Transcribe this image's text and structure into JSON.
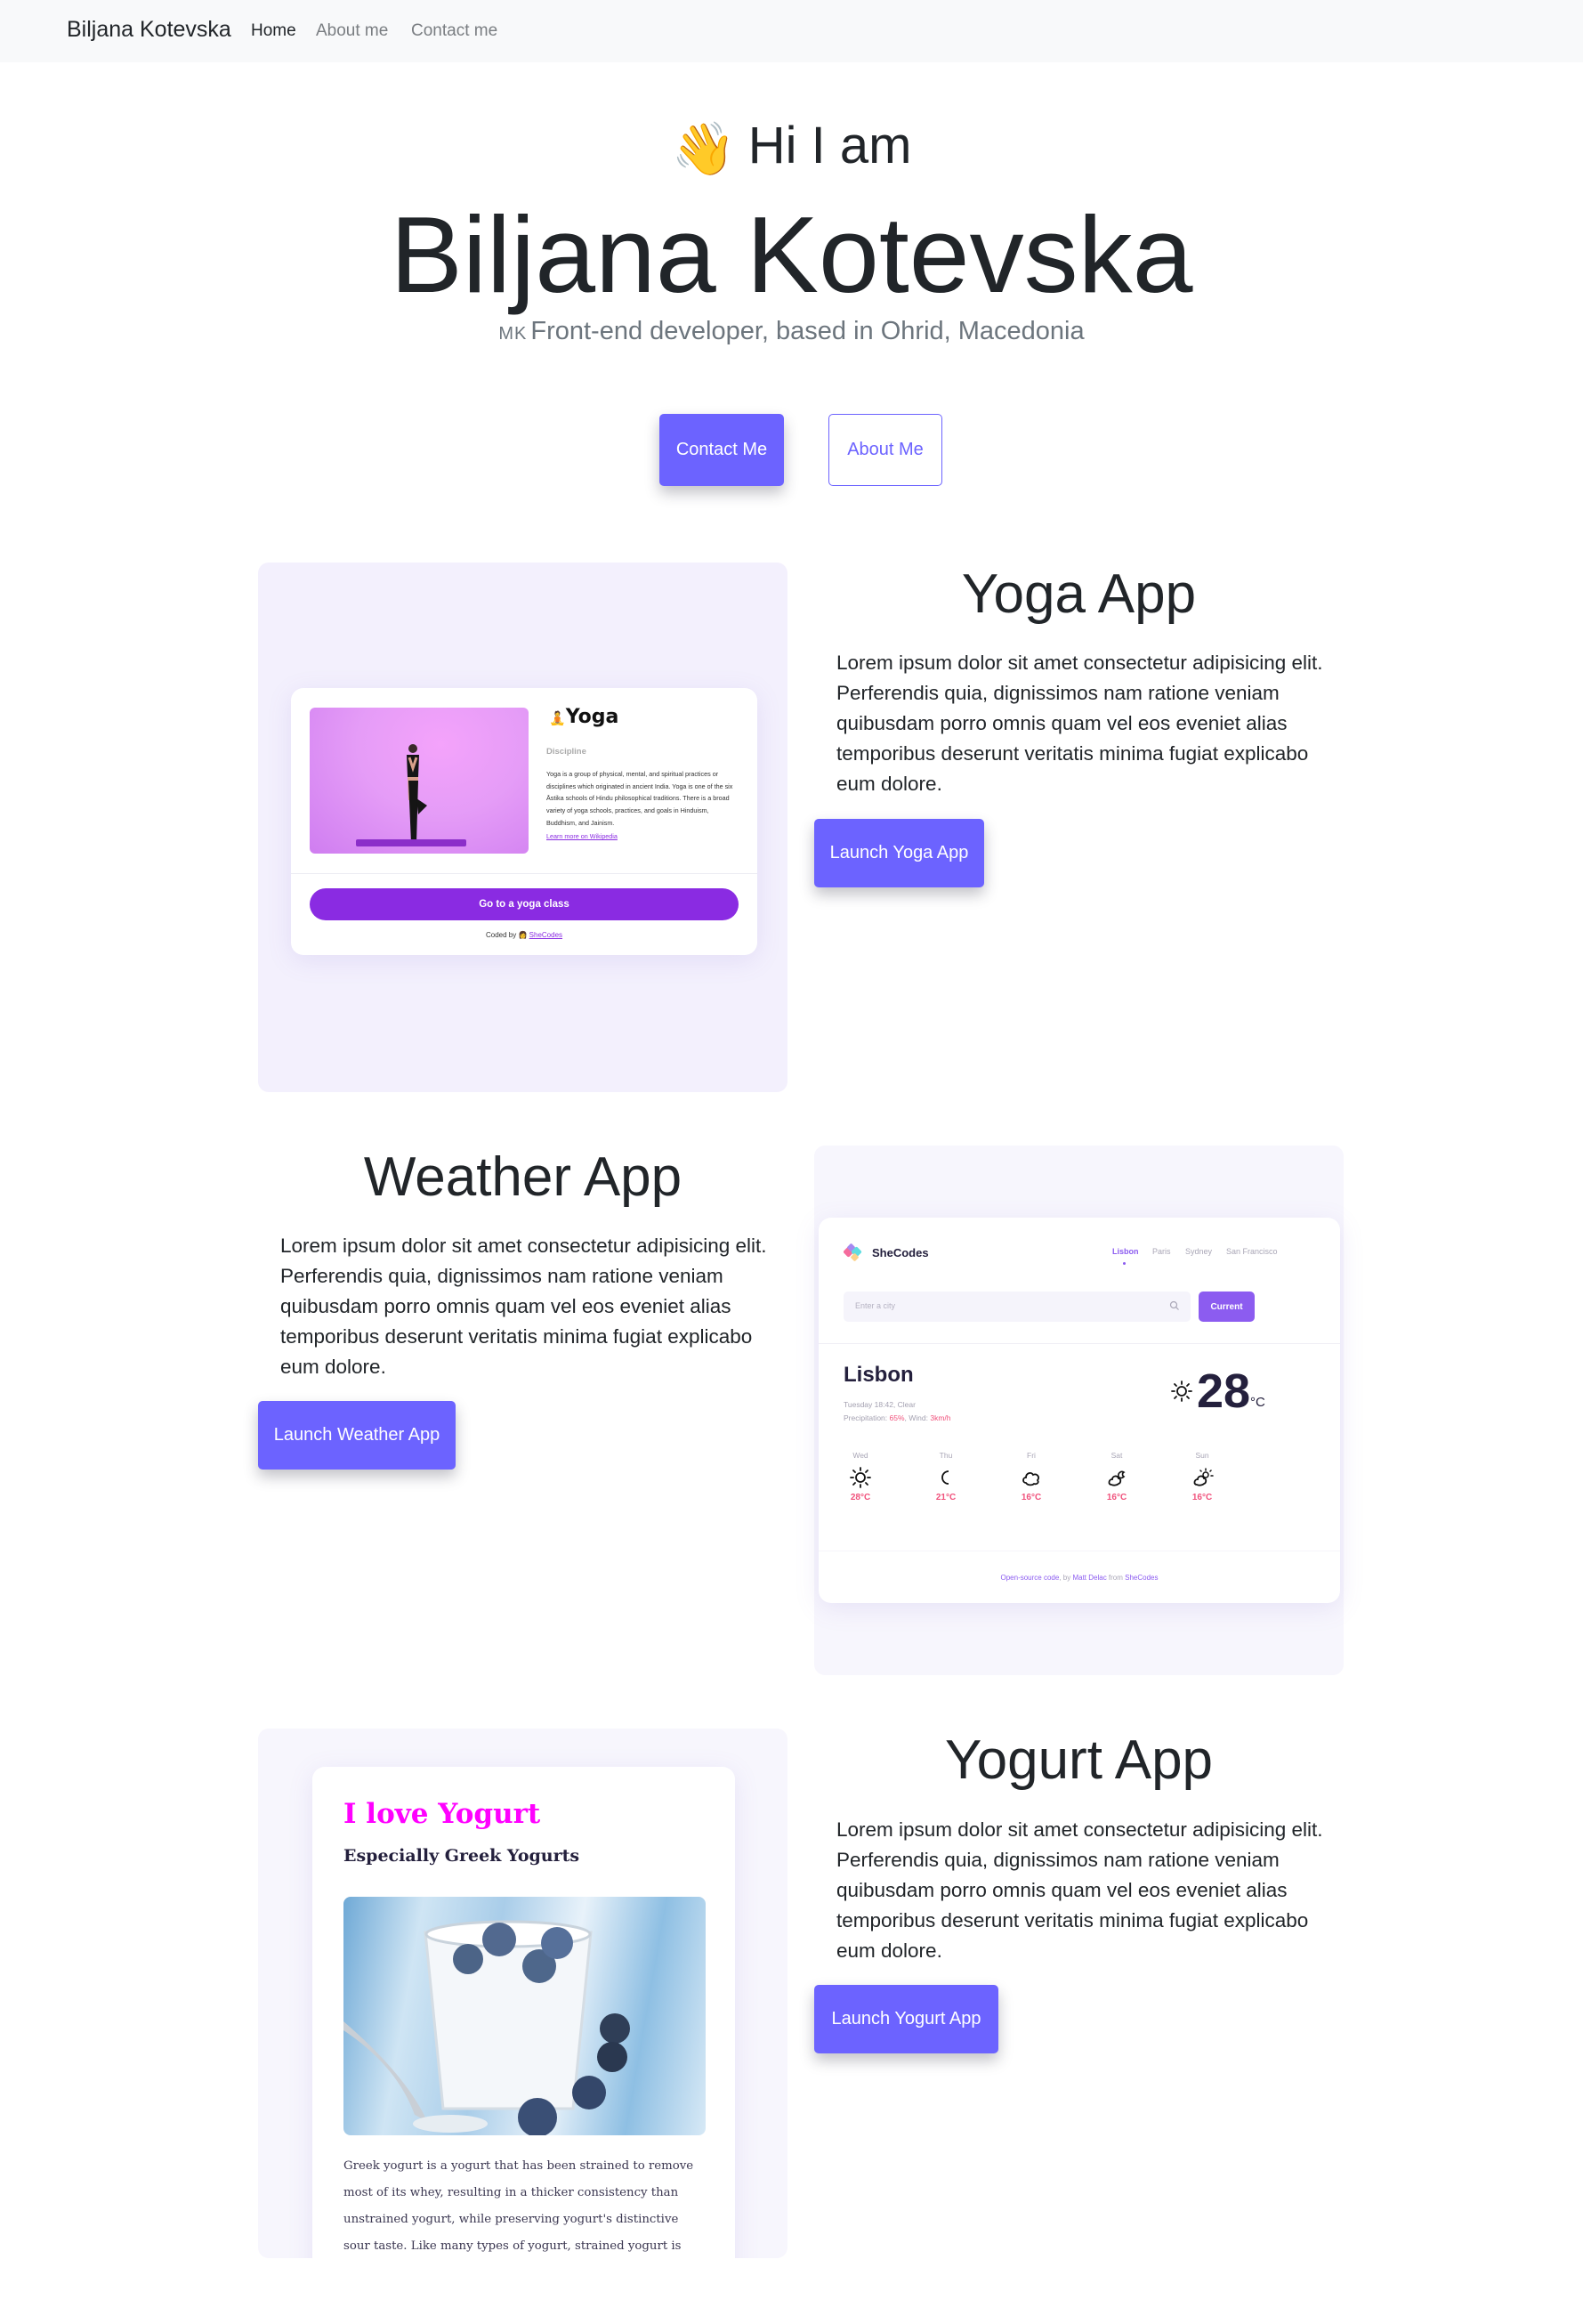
{
  "navbar": {
    "brand": "Biljana Kotevska",
    "links": [
      {
        "label": "Home",
        "active": true
      },
      {
        "label": "About me",
        "active": false
      },
      {
        "label": "Contact me",
        "active": false
      }
    ]
  },
  "hero": {
    "wave_icon": "👋",
    "greeting": "Hi I am",
    "name": "Biljana Kotevska",
    "flag": "MK",
    "subtitle": "Front-end developer, based in Ohrid, Macedonia",
    "contact_button": "Contact Me",
    "about_button": "About Me"
  },
  "colors": {
    "accent": "#6c63ff",
    "yoga_purple": "#8a2be2",
    "weather_purple": "#8c5cf0",
    "weather_pink": "#f0527c",
    "yogurt_magenta": "#ff00ff"
  },
  "projects": {
    "yoga": {
      "title": "Yoga App",
      "description": "Lorem ipsum dolor sit amet consectetur adipisicing elit. Perferendis quia, dignissimos nam ratione veniam quibusdam porro omnis quam vel eos eveniet alias temporibus deserunt veritatis minima fugiat explicabo eum dolore.",
      "launch_button": "Launch Yoga App",
      "preview": {
        "emoji": "🧘",
        "heading": "Yoga",
        "label": "Discipline",
        "text": "Yoga is a group of physical, mental, and spiritual practices or disciplines which originated in ancient India. Yoga is one of the six Āstika schools of Hindu philosophical traditions. There is a broad variety of yoga schools, practices, and goals in Hinduism, Buddhism, and Jainism.",
        "link": "Learn more on Wikipedia",
        "button": "Go to a yoga class",
        "footer_prefix": "Coded by",
        "footer_emoji": "👩",
        "footer_link": "SheCodes"
      }
    },
    "weather": {
      "title": "Weather App",
      "description": "Lorem ipsum dolor sit amet consectetur adipisicing elit. Perferendis quia, dignissimos nam ratione veniam quibusdam porro omnis quam vel eos eveniet alias temporibus deserunt veritatis minima fugiat explicabo eum dolore.",
      "launch_button": "Launch Weather App",
      "preview": {
        "logo_text": "SheCodes",
        "cities": [
          "Lisbon",
          "Paris",
          "Sydney",
          "San Francisco"
        ],
        "active_city": "Lisbon",
        "search_placeholder": "Enter a city",
        "current_button": "Current",
        "city": "Lisbon",
        "datetime": "Tuesday 18:42, Clear",
        "precip_label": "Precipitation:",
        "precip_value": "65%",
        "wind_label": ", Wind:",
        "wind_value": "3km/h",
        "temperature": "28",
        "unit": "°C",
        "now_icon": "sun-icon",
        "forecast": [
          {
            "day": "Wed",
            "icon": "sun-icon",
            "temp": "28°C"
          },
          {
            "day": "Thu",
            "icon": "moon-icon",
            "temp": "21°C"
          },
          {
            "day": "Fri",
            "icon": "cloud-icon",
            "temp": "16°C"
          },
          {
            "day": "Sat",
            "icon": "cloud-moon-icon",
            "temp": "16°C"
          },
          {
            "day": "Sun",
            "icon": "cloud-sun-icon",
            "temp": "16°C"
          }
        ],
        "footer": {
          "link1": "Open-source code",
          "by": ", by ",
          "author": "Matt Delac",
          "from": " from ",
          "org": "SheCodes"
        }
      }
    },
    "yogurt": {
      "title": "Yogurt App",
      "description": "Lorem ipsum dolor sit amet consectetur adipisicing elit. Perferendis quia, dignissimos nam ratione veniam quibusdam porro omnis quam vel eos eveniet alias temporibus deserunt veritatis minima fugiat explicabo eum dolore.",
      "launch_button": "Launch Yogurt App",
      "preview": {
        "heading": "I love Yogurt",
        "subheading": "Especially Greek Yogurts",
        "text": "Greek yogurt is a yogurt that has been strained to remove most of its whey, resulting in a thicker consistency than unstrained yogurt, while preserving yogurt's distinctive sour taste. Like many types of yogurt, strained yogurt is"
      }
    }
  }
}
